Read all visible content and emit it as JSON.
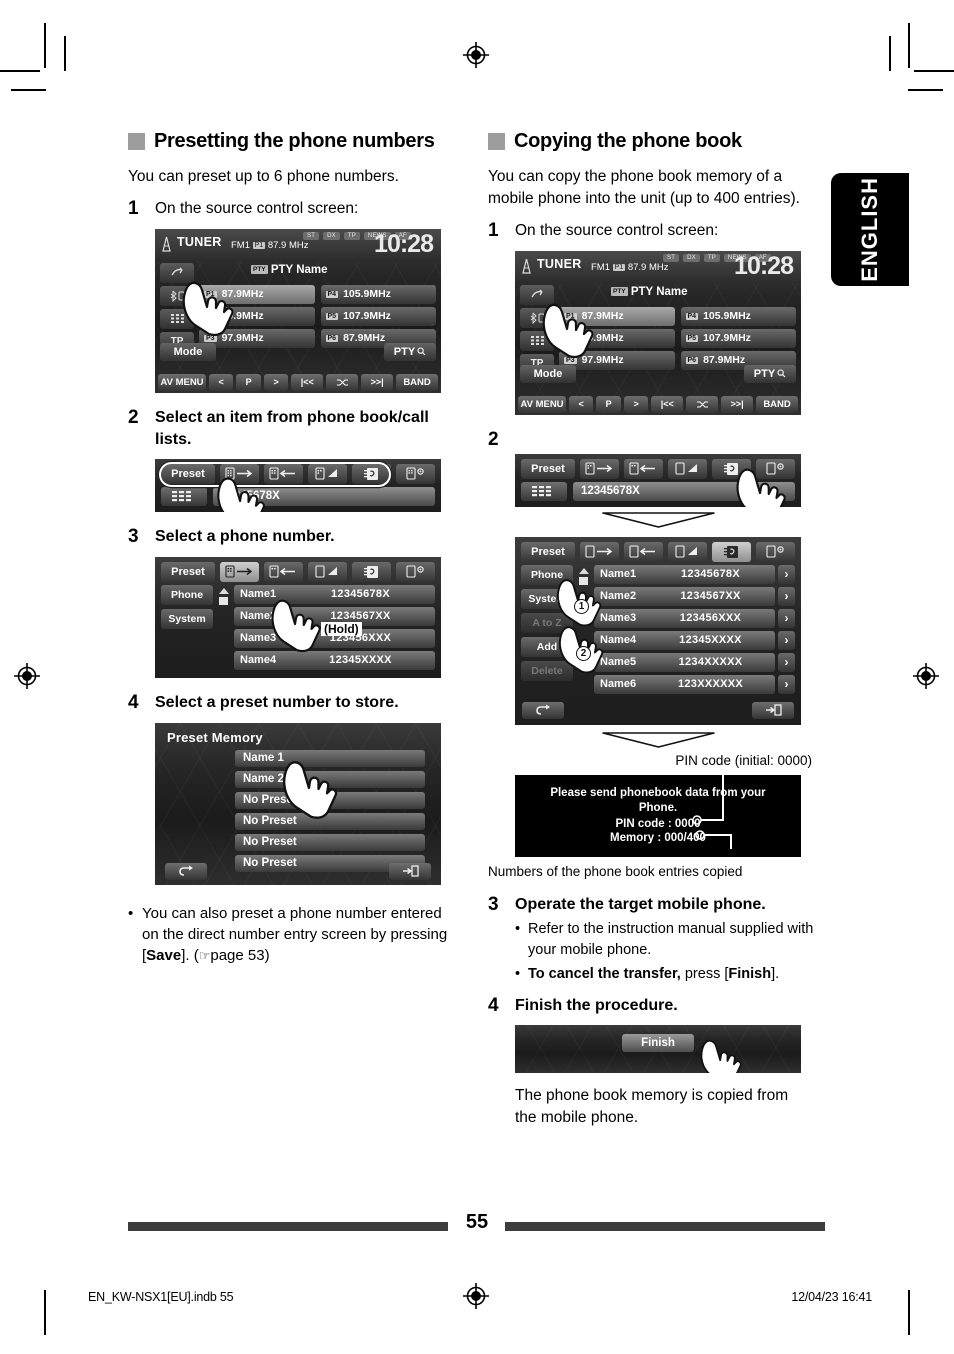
{
  "page": {
    "number": "55",
    "language_tab": "ENGLISH",
    "footer_left": "EN_KW-NSX1[EU].indb   55",
    "footer_right": "12/04/23   16:41"
  },
  "left_column": {
    "heading": "Presetting the phone numbers",
    "intro": "You can preset up to 6 phone numbers.",
    "steps": [
      {
        "num": "1",
        "text": "On the source control screen:"
      },
      {
        "num": "2",
        "text": "Select an item from phone book/call lists."
      },
      {
        "num": "3",
        "text": "Select a phone number."
      },
      {
        "num": "4",
        "text": "Select a preset number to store."
      }
    ],
    "note": {
      "part1": "You can also preset a phone number entered on the direct number entry screen by pressing [",
      "bold": "Save",
      "part2": "]. (",
      "hand_icon": "pointing-hand-icon",
      "part3": "page 53)"
    },
    "tuner_screen": {
      "source": "TUNER",
      "band": "FM1",
      "preset_badge": "P1",
      "frequency": "87.9 MHz",
      "flags": [
        "ST",
        "DX",
        "TP",
        "NEWS",
        "AF"
      ],
      "clock": "10:28",
      "pty_label": "PTY Name",
      "side_buttons": [
        "traffic-icon",
        "bluetooth-phone-icon",
        "keypad-icon",
        "TP"
      ],
      "presets": [
        {
          "num": "P1",
          "freq": "87.9MHz",
          "selected": true
        },
        {
          "num": "P4",
          "freq": "105.9MHz",
          "selected": false
        },
        {
          "num": "P2",
          "freq": "89.9MHz",
          "selected": false
        },
        {
          "num": "P5",
          "freq": "107.9MHz",
          "selected": false
        },
        {
          "num": "P3",
          "freq": "97.9MHz",
          "selected": false
        },
        {
          "num": "P6",
          "freq": "87.9MHz",
          "selected": false
        }
      ],
      "mode_button": "Mode",
      "pty_button": "PTY",
      "bottom_bar": [
        "AV MENU",
        "<",
        "P",
        ">",
        "|<<",
        "shuffle-icon",
        ">>|",
        "BAND"
      ]
    },
    "step2_screen": {
      "toolbar": [
        "Preset",
        "phone-out-icon",
        "phone-in-icon",
        "phone-missed-icon",
        "phonebook-icon",
        "phone-settings-icon"
      ],
      "keypad_icon": "keypad-icon",
      "number_field": "12345678X"
    },
    "step3_screen": {
      "toolbar": [
        "Preset",
        "phone-out-icon",
        "phone-in-icon",
        "phone-missed-icon",
        "phonebook-icon",
        "phone-settings-icon"
      ],
      "side_buttons": [
        "Phone",
        "System"
      ],
      "hold_label": "(Hold)",
      "entries": [
        {
          "name": "Name1",
          "number": "12345678X"
        },
        {
          "name": "Name2",
          "number": "1234567XX"
        },
        {
          "name": "Name3",
          "number": "123456XXX"
        },
        {
          "name": "Name4",
          "number": "12345XXXX"
        }
      ]
    },
    "step4_screen": {
      "title": "Preset Memory",
      "items": [
        "Name 1",
        "Name 2",
        "No Preset",
        "No Preset",
        "No Preset",
        "No Preset"
      ],
      "back_icon": "back-arrow-icon",
      "exit_icon": "exit-icon"
    }
  },
  "right_column": {
    "heading": "Copying the phone book",
    "intro": "You can copy the phone book memory of a mobile phone into the unit (up to 400 entries).",
    "steps": [
      {
        "num": "1",
        "text": "On the source control screen:"
      },
      {
        "num": "2",
        "text": ""
      },
      {
        "num": "3",
        "text": "Operate the target mobile phone."
      },
      {
        "num": "4",
        "text": "Finish the procedure."
      }
    ],
    "step3_bullets": [
      {
        "plain": "Refer to the instruction manual supplied with your mobile phone."
      },
      {
        "bold": "To cancel the transfer,",
        "plain": " press [",
        "bold2": "Finish",
        "plain2": "]."
      }
    ],
    "final_text": "The phone book memory is copied from the mobile phone.",
    "tuner_screen": {
      "source": "TUNER",
      "band": "FM1",
      "preset_badge": "P1",
      "frequency": "87.9 MHz",
      "flags": [
        "ST",
        "DX",
        "TP",
        "NEWS",
        "AF"
      ],
      "clock": "10:28",
      "pty_label": "PTY Name",
      "presets": [
        {
          "num": "P1",
          "freq": "87.9MHz",
          "selected": true
        },
        {
          "num": "P4",
          "freq": "105.9MHz",
          "selected": false
        },
        {
          "num": "P2",
          "freq": "89.9MHz",
          "selected": false
        },
        {
          "num": "P5",
          "freq": "107.9MHz",
          "selected": false
        },
        {
          "num": "P3",
          "freq": "97.9MHz",
          "selected": false
        },
        {
          "num": "P6",
          "freq": "87.9MHz",
          "selected": false
        }
      ],
      "mode_button": "Mode",
      "pty_button": "PTY",
      "bottom_bar": [
        "AV MENU",
        "<",
        "P",
        ">",
        "|<<",
        "shuffle-icon",
        ">>|",
        "BAND"
      ]
    },
    "step2_screen_a": {
      "toolbar": [
        "Preset",
        "phone-out-icon",
        "phone-in-icon",
        "phone-missed-icon",
        "phonebook-icon",
        "phone-settings-icon"
      ],
      "keypad_icon": "keypad-icon",
      "number_field": "12345678X"
    },
    "step2_screen_b": {
      "toolbar": [
        "Preset",
        "phone-out-icon",
        "phone-in-icon",
        "phone-missed-icon",
        "phonebook-icon",
        "phone-settings-icon"
      ],
      "side_buttons": [
        "Phone",
        "System",
        "A to Z",
        "Add",
        "Delete"
      ],
      "marker1": "1",
      "marker2": "2",
      "entries": [
        {
          "name": "Name1",
          "number": "12345678X"
        },
        {
          "name": "Name2",
          "number": "1234567XX"
        },
        {
          "name": "Name3",
          "number": "123456XXX"
        },
        {
          "name": "Name4",
          "number": "12345XXXX"
        },
        {
          "name": "Name5",
          "number": "1234XXXXX"
        },
        {
          "name": "Name6",
          "number": "123XXXXXX"
        }
      ],
      "back_icon": "back-arrow-icon",
      "exit_icon": "exit-icon"
    },
    "pin_callout_top": "PIN code (initial: 0000)",
    "pin_callout_bottom": "Numbers of the phone book entries copied",
    "pin_dialog": {
      "line1": "Please send phonebook data from your",
      "line1b": "Phone.",
      "line2": "PIN code : 0000",
      "line3": "Memory : 000/400"
    },
    "finish_screen": {
      "button": "Finish"
    }
  }
}
